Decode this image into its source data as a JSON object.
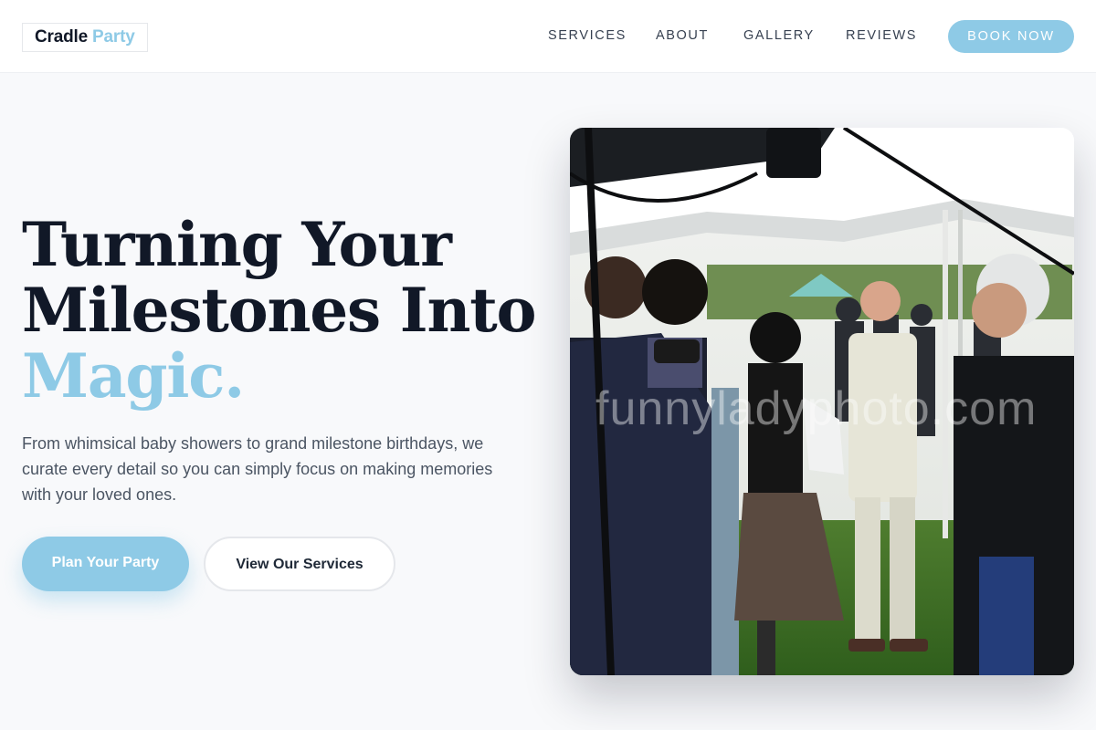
{
  "brand": {
    "name": "Cradle",
    "accent": "Party"
  },
  "nav": {
    "items": [
      "SERVICES",
      "ABOUT",
      "GALLERY",
      "REVIEWS"
    ],
    "cta": "BOOK NOW"
  },
  "hero": {
    "headline_line1": "Turning Your",
    "headline_line2": "Milestones Into",
    "headline_accent": "Magic.",
    "description": "From whimsical baby showers to grand milestone birthdays, we curate every detail so you can simply focus on making memories with your loved ones.",
    "primary_button": "Plan Your Party",
    "secondary_button": "View Our Services",
    "image_watermark": "funnyladyphoto.com"
  },
  "colors": {
    "accent": "#8ecae6",
    "text_dark": "#111827",
    "text_muted": "#4b5563",
    "background": "#f8f9fb"
  }
}
